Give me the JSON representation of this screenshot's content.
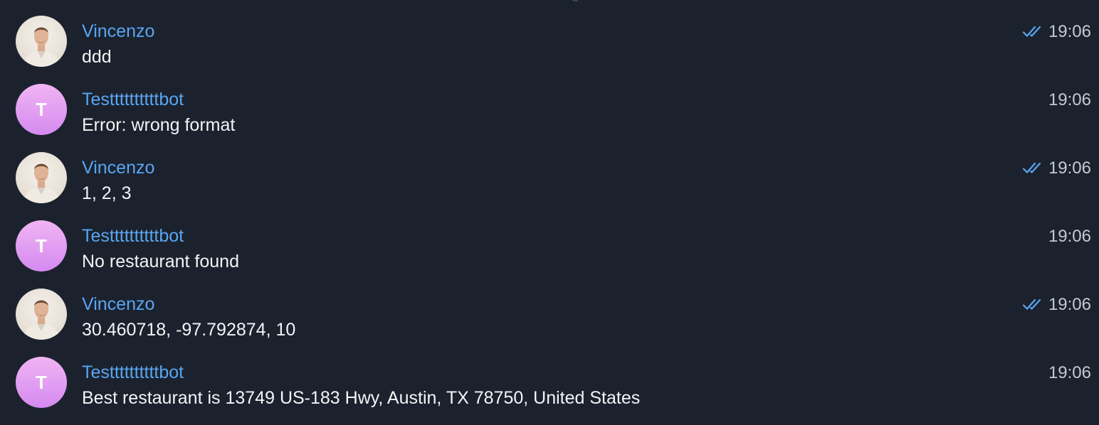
{
  "messages": [
    {
      "sender": "Vincenzo",
      "avatar": "photo",
      "text": "ddd",
      "time": "19:06",
      "read": true
    },
    {
      "sender": "Testtttttttttbot",
      "avatar": "T",
      "text": "Error: wrong format",
      "time": "19:06",
      "read": false
    },
    {
      "sender": "Vincenzo",
      "avatar": "photo",
      "text": "1, 2, 3",
      "time": "19:06",
      "read": true
    },
    {
      "sender": "Testtttttttttbot",
      "avatar": "T",
      "text": "No restaurant found",
      "time": "19:06",
      "read": false
    },
    {
      "sender": "Vincenzo",
      "avatar": "photo",
      "text": "30.460718, -97.792874, 10",
      "time": "19:06",
      "read": true
    },
    {
      "sender": "Testtttttttttbot",
      "avatar": "T",
      "text": "Best restaurant is 13749 US-183 Hwy, Austin, TX 78750, United States",
      "time": "19:06",
      "read": false
    }
  ],
  "colors": {
    "background": "#1b222d",
    "sender_name": "#5aa5f2",
    "message_text": "#f2f4f6",
    "timestamp": "#c4c9d0",
    "read_check": "#5aa5f2",
    "bot_avatar_gradient": [
      "#f0b4f3",
      "#d58af0"
    ]
  },
  "icons": {
    "read_receipt": "double-check-icon",
    "user_avatar": "user-photo-avatar",
    "bot_avatar": "letter-avatar"
  }
}
